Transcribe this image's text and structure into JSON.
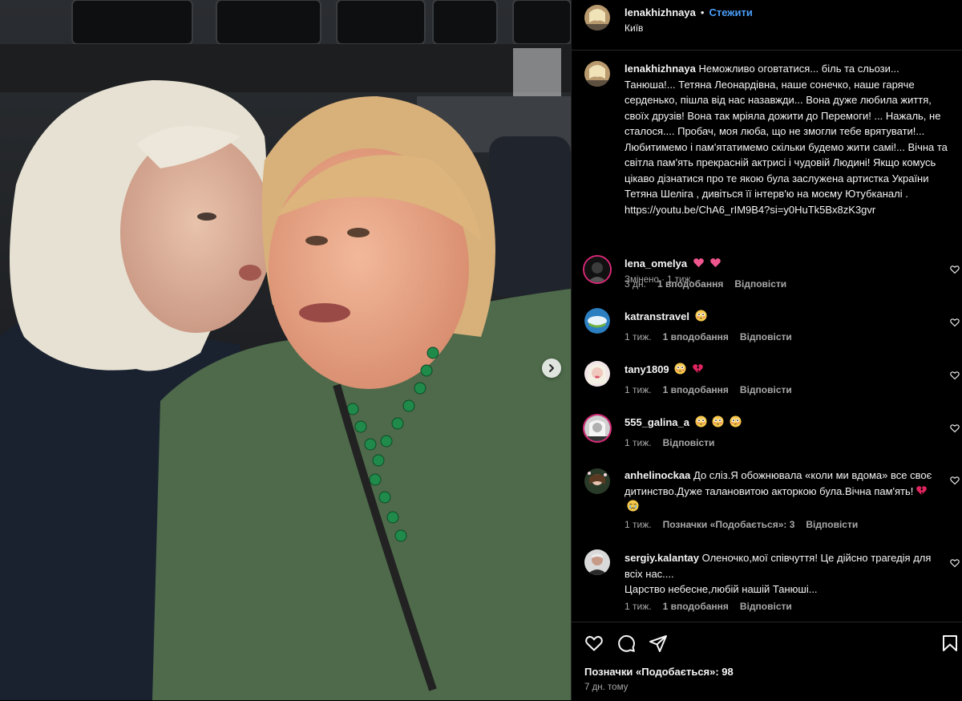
{
  "post": {
    "username": "lenakhizhnaya",
    "follow_label": "Стежити",
    "separator": "•",
    "location": "Київ"
  },
  "caption": {
    "username": "lenakhizhnaya",
    "text": "Неможливо оговтатися... біль та сльози... Танюша!... Тетяна Леонардівна, наше сонечко, наше гаряче серденько, пішла від нас назавжди... Вона дуже любила життя, своїх друзів! Вона так мріяла дожити до Перемоги! ... Нажаль, не сталося.... Пробач, моя люба, що не змогли тебе врятувати!... Любитимемо і пам'ятатимемо скільки будемо жити самі!... Вічна та світла пам'ять прекрасній актрисі і чудовій Людині! Якщо комусь цікаво дізнатися про те якою була заслужена артистка України Тетяна Шеліга , дивіться її інтерв'ю на моєму Ютубканалі . https://youtu.be/ChA6_rIM9B4?si=y0HuTk5Bx8zK3gvr",
    "edited": "Змінено",
    "dot": "·",
    "age": "1 тиж."
  },
  "comments": [
    {
      "username": "lena_omelya",
      "text": "",
      "emoji": [
        "pink-heart",
        "pink-heart"
      ],
      "age": "3 дн.",
      "likes": "1 вподобання",
      "reply": "Відповісти"
    },
    {
      "username": "katranstravel",
      "text": "",
      "emoji": [
        "flushed-face"
      ],
      "age": "1 тиж.",
      "likes": "1 вподобання",
      "reply": "Відповісти"
    },
    {
      "username": "tany1809",
      "text": "",
      "emoji": [
        "flushed-face",
        "broken-heart"
      ],
      "age": "1 тиж.",
      "likes": "1 вподобання",
      "reply": "Відповісти"
    },
    {
      "username": "555_galina_a",
      "text": "",
      "emoji": [
        "flushed-face",
        "flushed-face",
        "flushed-face"
      ],
      "age": "1 тиж.",
      "likes": "",
      "reply": "Відповісти"
    },
    {
      "username": "anhelinockaa",
      "text": "До сліз.Я обожнювала «коли ми вдома» все своє дитинство.Дуже талановитою акторкою була.Вічна пам'ять!",
      "emoji": [
        "broken-heart",
        "crying-face"
      ],
      "age": "1 тиж.",
      "likes": "Позначки «Подобається»: 3",
      "reply": "Відповісти"
    },
    {
      "username": "sergiy.kalantay",
      "text": "Оленочко,мої співчуття! Це дійсно трагедія для всіх нас....",
      "text2": "Царство небесне,любій нашій Танюші...",
      "emoji": [],
      "age": "1 тиж.",
      "likes": "1 вподобання",
      "reply": "Відповісти"
    }
  ],
  "footer": {
    "likes": "Позначки «Подобається»: 98",
    "time": "7 дн. тому"
  },
  "icons": {
    "like": "heart-icon",
    "comment": "comment-icon",
    "share": "share-icon",
    "save": "bookmark-icon",
    "next": "chevron-right-icon"
  },
  "colors": {
    "link": "#4a9df8",
    "muted": "#a8a8a8",
    "background": "#000000"
  }
}
